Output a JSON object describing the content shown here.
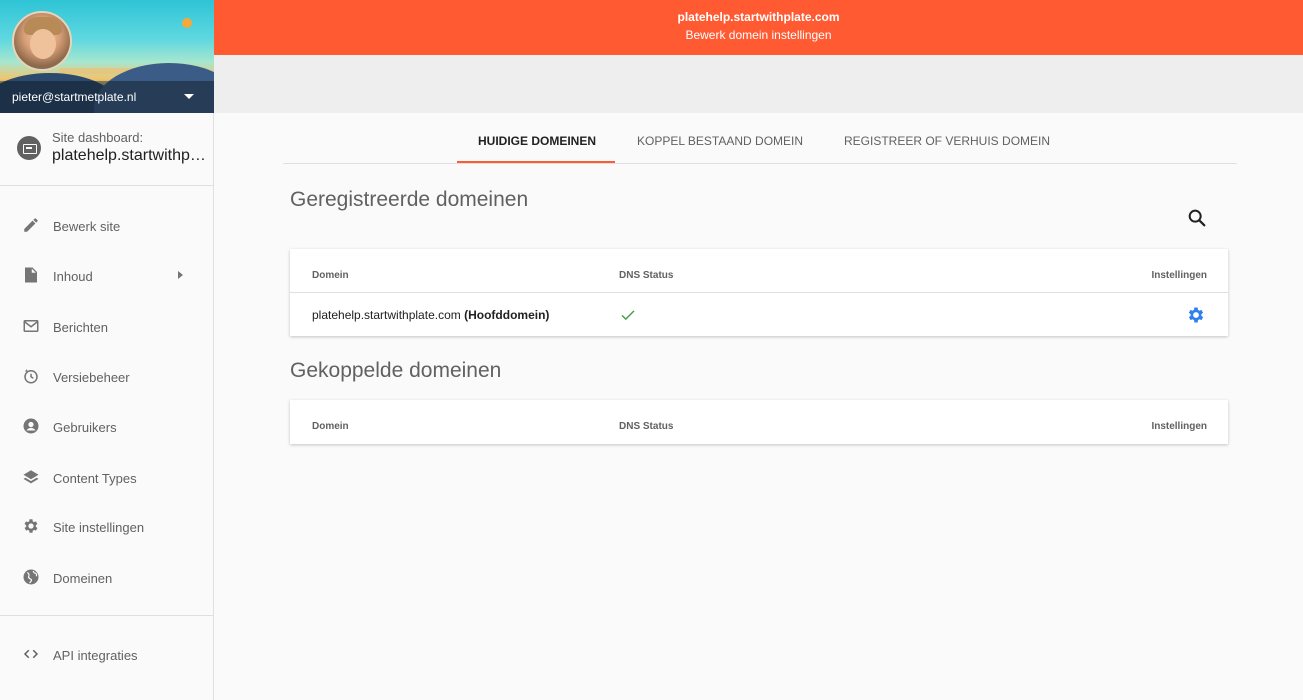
{
  "profile": {
    "email": "pieter@startmetplate.nl"
  },
  "site": {
    "caption": "Site dashboard:",
    "name": "platehelp.startwithplate.com"
  },
  "nav": {
    "items": [
      {
        "label": "Bewerk site",
        "icon": "pencil-icon"
      },
      {
        "label": "Inhoud",
        "icon": "document-icon"
      },
      {
        "label": "Berichten",
        "icon": "mail-icon"
      },
      {
        "label": "Versiebeheer",
        "icon": "history-icon"
      },
      {
        "label": "Gebruikers",
        "icon": "user-icon"
      },
      {
        "label": "Content Types",
        "icon": "layers-icon"
      },
      {
        "label": "Site instellingen",
        "icon": "gear-icon"
      },
      {
        "label": "Domeinen",
        "icon": "globe-icon"
      },
      {
        "label": "API integraties",
        "icon": "code-icon"
      }
    ]
  },
  "header": {
    "title": "platehelp.startwithplate.com",
    "subtitle": "Bewerk domein instellingen",
    "accent": "#ff5a32"
  },
  "tabs": [
    {
      "label": "HUIDIGE DOMEINEN",
      "active": true
    },
    {
      "label": "KOPPEL BESTAAND DOMEIN",
      "active": false
    },
    {
      "label": "REGISTREER OF VERHUIS DOMEIN",
      "active": false
    }
  ],
  "registered": {
    "title": "Geregistreerde domeinen",
    "columns": [
      "Domein",
      "DNS Status",
      "Instellingen"
    ],
    "rows": [
      {
        "domain": "platehelp.startwithplate.com",
        "tag": "(Hoofddomein)",
        "dns_ok": true
      }
    ]
  },
  "linked": {
    "title": "Gekoppelde domeinen",
    "columns": [
      "Domein",
      "DNS Status",
      "Instellingen"
    ]
  },
  "colors": {
    "check": "#43a047",
    "gear": "#2f80ed"
  }
}
